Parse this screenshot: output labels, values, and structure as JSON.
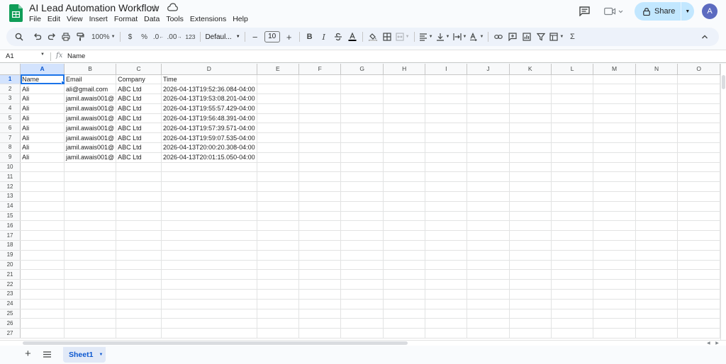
{
  "app": {
    "title": "AI Lead Automation Workflow",
    "menu": [
      "File",
      "Edit",
      "View",
      "Insert",
      "Format",
      "Data",
      "Tools",
      "Extensions",
      "Help"
    ],
    "share_label": "Share",
    "avatar_letter": "A",
    "brand_color": "#0f9d58",
    "accent_color": "#0b57d0"
  },
  "toolbar": {
    "zoom": "100%",
    "currency": "$",
    "percent": "%",
    "decrease_decimal": ".0",
    "increase_decimal": ".00",
    "number_format": "123",
    "font_family": "Defaul...",
    "font_size": "10",
    "icons": [
      "search-icon",
      "undo-icon",
      "redo-icon",
      "print-icon",
      "paint-format-icon",
      "bold-icon",
      "italic-icon",
      "strikethrough-icon",
      "text-color-icon",
      "fill-color-icon",
      "borders-icon",
      "merge-icon",
      "align-icon",
      "valign-icon",
      "wrap-icon",
      "rotate-icon",
      "link-icon",
      "comment-icon",
      "chart-icon",
      "filter-icon",
      "filter-views-icon",
      "functions-icon",
      "collapse-icon"
    ]
  },
  "formula_bar": {
    "cell_ref": "A1",
    "fx": "fx",
    "value": "Name"
  },
  "grid": {
    "columns": [
      "A",
      "B",
      "C",
      "D",
      "E",
      "F",
      "G",
      "H",
      "I",
      "J",
      "K",
      "L",
      "M",
      "N",
      "O"
    ],
    "rows": [
      [
        "Name",
        "Email",
        "Company",
        "Time"
      ],
      [
        "Ali",
        "ali@gmail.com",
        "ABC Ltd",
        "2026-04-13T19:52:36.084-04:00"
      ],
      [
        "Ali",
        "jamil.awais001@",
        "ABC Ltd",
        "2026-04-13T19:53:08.201-04:00"
      ],
      [
        "Ali",
        "jamil.awais001@",
        "ABC Ltd",
        "2026-04-13T19:55:57.429-04:00"
      ],
      [
        "Ali",
        "jamil.awais001@",
        "ABC Ltd",
        "2026-04-13T19:56:48.391-04:00"
      ],
      [
        "Ali",
        "jamil.awais001@",
        "ABC Ltd",
        "2026-04-13T19:57:39.571-04:00"
      ],
      [
        "Ali",
        "jamil.awais001@",
        "ABC Ltd",
        "2026-04-13T19:59:07.535-04:00"
      ],
      [
        "Ali",
        "jamil.awais001@",
        "ABC Ltd",
        "2026-04-13T20:00:20.308-04:00"
      ],
      [
        "Ali",
        "jamil.awais001@",
        "ABC Ltd",
        "2026-04-13T20:01:15.050-04:00"
      ]
    ],
    "row_count": 27,
    "active_cell": "A1"
  },
  "sheets": [
    {
      "name": "Sheet1",
      "active": true
    }
  ]
}
